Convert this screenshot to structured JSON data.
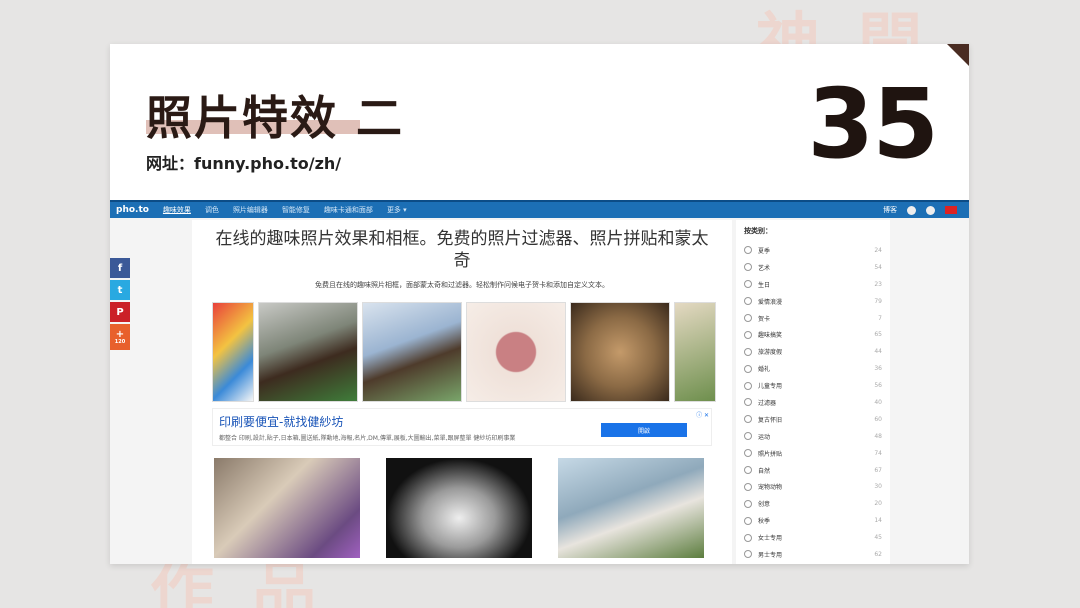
{
  "slide": {
    "title": "照片特效 二",
    "subtitle": "网址：funny.pho.to/zh/",
    "number": "35"
  },
  "screenshot": {
    "nav": {
      "logo": "pho.to",
      "items": [
        "趣味效果",
        "调色",
        "照片编辑器",
        "智能修复",
        "趣味卡通和面部",
        "更多 ▾"
      ],
      "right_label": "博客"
    },
    "share": {
      "facebook": "f",
      "twitter": "t",
      "pinterest": "P",
      "plus": "+",
      "plus_count": "120"
    },
    "main": {
      "heading": "在线的趣味照片效果和相框。免费的照片过滤器、照片拼贴和蒙太奇",
      "description": "免费且在线的趣味照片相框，面部蒙太奇和过滤器。轻松制作问候电子贺卡和添加自定义文本。"
    },
    "ad": {
      "title": "印刷要便宜-就找健紗坊",
      "text": "都整合 印刷,設計,貼子,日本箱,圖送紙,隊動地,海報,名片,DM,傳單,展板,大圖輸出,菜單,跟屏整單 健紗坊印刷事業",
      "button": "開啟",
      "mark": "ⓘ ✕"
    },
    "sidebar": {
      "title": "按类别：",
      "categories": [
        {
          "label": "夏季",
          "count": "24"
        },
        {
          "label": "艺术",
          "count": "54"
        },
        {
          "label": "生日",
          "count": "23"
        },
        {
          "label": "爱情浪漫",
          "count": "79"
        },
        {
          "label": "贺卡",
          "count": "7"
        },
        {
          "label": "趣味搞笑",
          "count": "65"
        },
        {
          "label": "旅游度假",
          "count": "44"
        },
        {
          "label": "婚礼",
          "count": "36"
        },
        {
          "label": "儿童专用",
          "count": "56"
        },
        {
          "label": "过滤器",
          "count": "40"
        },
        {
          "label": "复古怀旧",
          "count": "60"
        },
        {
          "label": "运动",
          "count": "48"
        },
        {
          "label": "照片拼贴",
          "count": "74"
        },
        {
          "label": "自然",
          "count": "67"
        },
        {
          "label": "宠物动物",
          "count": "30"
        },
        {
          "label": "创意",
          "count": "20"
        },
        {
          "label": "秋季",
          "count": "14"
        },
        {
          "label": "女士专用",
          "count": "45"
        },
        {
          "label": "男士专用",
          "count": "62"
        }
      ]
    },
    "colors": {
      "nav": "#1c6fb5",
      "accent": "#d8b0a6"
    }
  }
}
